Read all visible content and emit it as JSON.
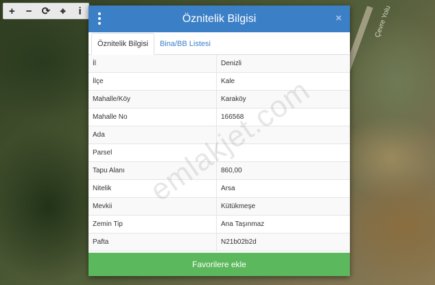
{
  "map": {
    "road_label": "Çevre Yolu"
  },
  "toolbar": {
    "zoom_in": "+",
    "zoom_out": "−",
    "refresh": "⟳",
    "locate": "⌖",
    "info": "i"
  },
  "modal": {
    "title": "Öznitelik Bilgisi",
    "close": "×",
    "tabs": [
      {
        "label": "Öznitelik Bilgisi",
        "active": true
      },
      {
        "label": "Bina/BB Listesi",
        "active": false
      }
    ],
    "rows": [
      {
        "label": "İl",
        "value": "Denizli"
      },
      {
        "label": "İlçe",
        "value": "Kale"
      },
      {
        "label": "Mahalle/Köy",
        "value": "Karaköy"
      },
      {
        "label": "Mahalle No",
        "value": "166568"
      },
      {
        "label": "Ada",
        "value": ""
      },
      {
        "label": "Parsel",
        "value": ""
      },
      {
        "label": "Tapu Alanı",
        "value": "860,00"
      },
      {
        "label": "Nitelik",
        "value": "Arsa"
      },
      {
        "label": "Mevkii",
        "value": "Kütükmeşe"
      },
      {
        "label": "Zemin Tip",
        "value": "Ana Taşınmaz"
      },
      {
        "label": "Pafta",
        "value": "N21b02b2d"
      }
    ],
    "footer_button": "Favorilere ekle"
  },
  "watermark": "emlakjet.com",
  "colors": {
    "header": "#3b7fc7",
    "footer_button": "#5cb85c"
  }
}
